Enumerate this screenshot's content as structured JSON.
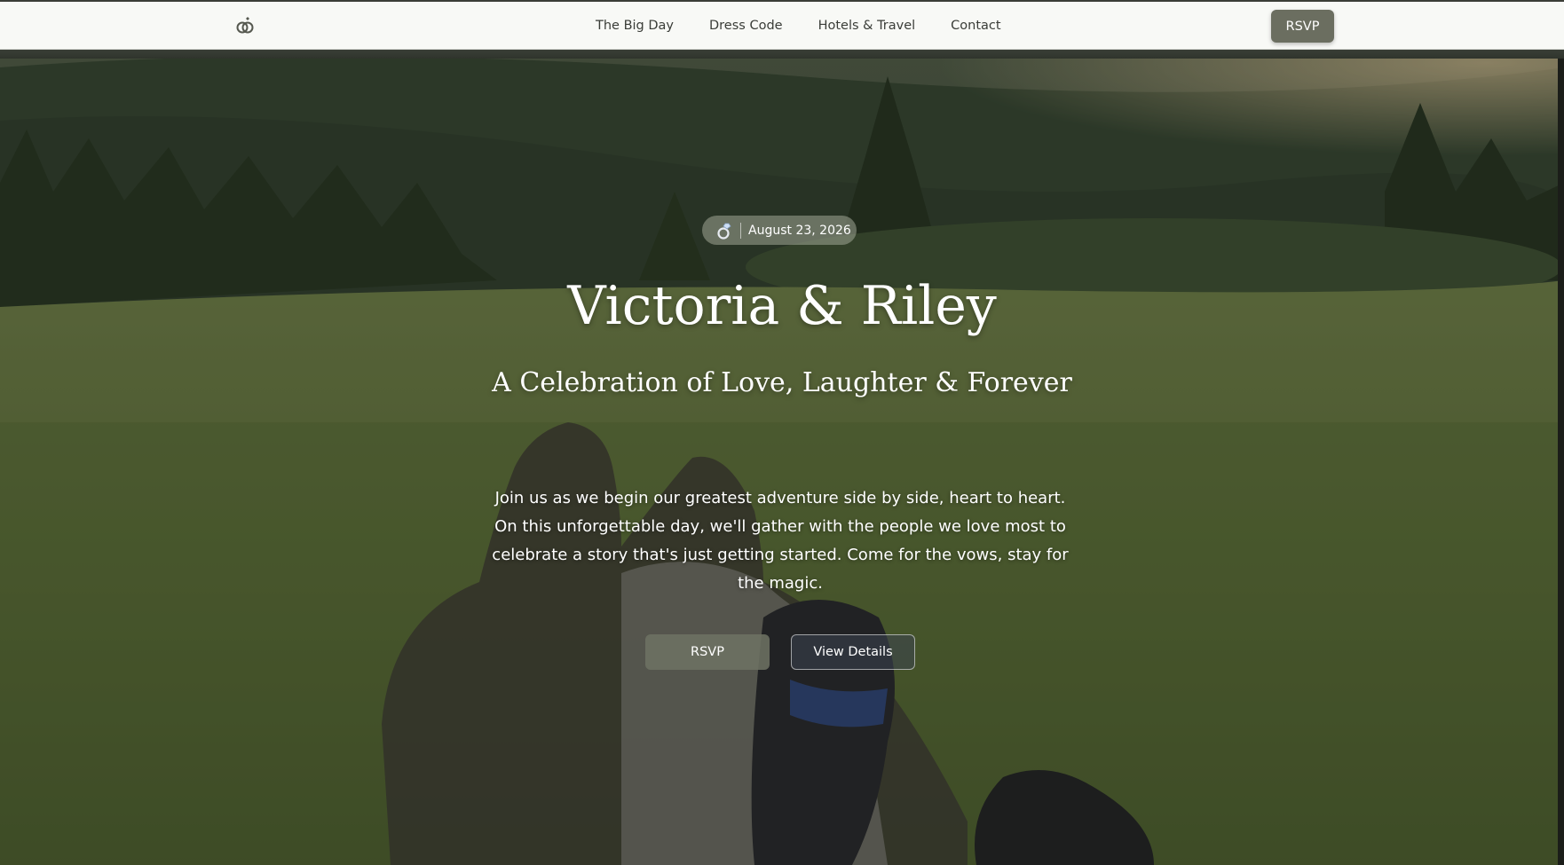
{
  "nav": {
    "logo_icon": "wedding-rings-icon",
    "links": [
      {
        "label": "The Big Day"
      },
      {
        "label": "Dress Code"
      },
      {
        "label": "Hotels & Travel"
      },
      {
        "label": "Contact"
      }
    ],
    "rsvp_label": "RSVP"
  },
  "hero": {
    "date_icon": "ring-icon",
    "date": "August 23, 2026",
    "title": "Victoria & Riley",
    "subtitle": "A Celebration of Love, Laughter & Forever",
    "intro": "Join us as we begin our greatest adventure side by side, heart to heart. On this unforgettable day, we'll gather with the people we love most to celebrate a story that's just getting started. Come for the vows, stay for the magic.",
    "primary_button": "RSVP",
    "secondary_button": "View Details"
  },
  "colors": {
    "nav_background": "#f8f9f6",
    "nav_text": "#3a3d38",
    "accent": "#6b6e60",
    "hero_text": "#ffffff"
  }
}
